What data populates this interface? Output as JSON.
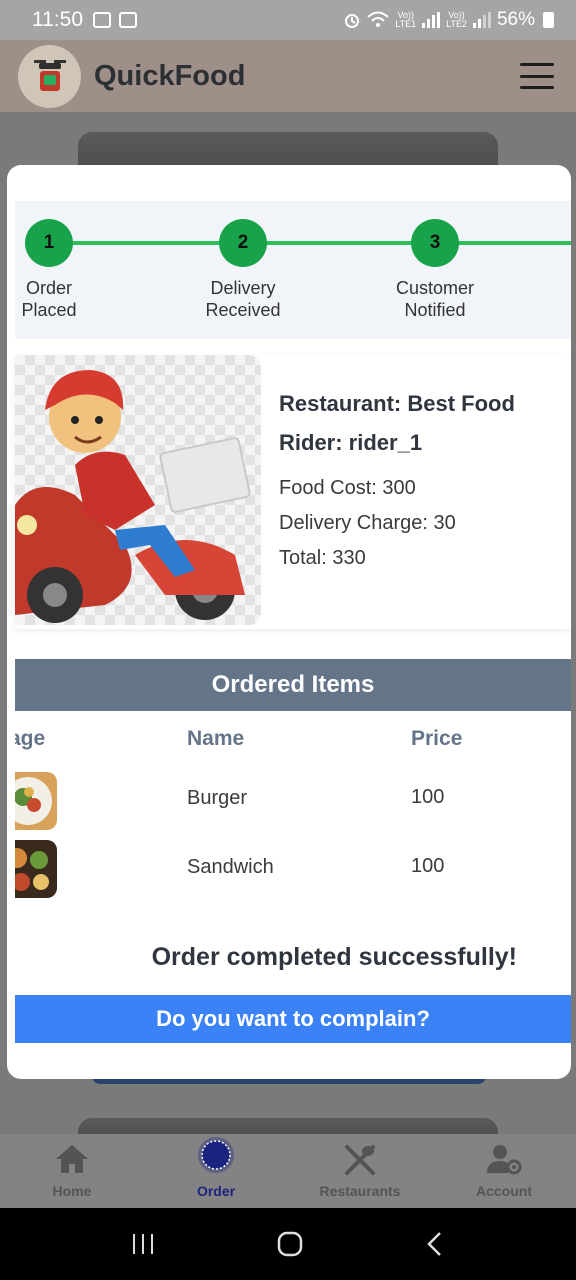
{
  "status_bar": {
    "time": "11:50",
    "battery": "56%",
    "sim1": "LTE1",
    "sim2": "LTE2",
    "volte": "Vo))"
  },
  "header": {
    "app_title": "QuickFood"
  },
  "stepper": {
    "steps": [
      {
        "number": "1",
        "label_line1": "Order",
        "label_line2": "Placed"
      },
      {
        "number": "2",
        "label_line1": "Delivery",
        "label_line2": "Received"
      },
      {
        "number": "3",
        "label_line1": "Customer",
        "label_line2": "Notified"
      }
    ]
  },
  "order": {
    "restaurant": "Restaurant: Best Food",
    "rider": "Rider: rider_1",
    "food_cost": "Food Cost: 300",
    "delivery_charge": "Delivery Charge: 30",
    "total": "Total: 330"
  },
  "items": {
    "title": "Ordered Items",
    "columns": {
      "image": "age",
      "name": "Name",
      "price": "Price"
    },
    "rows": [
      {
        "name": "Burger",
        "price": "100"
      },
      {
        "name": "Sandwich",
        "price": "100"
      }
    ]
  },
  "success_message": "Order completed successfully!",
  "complain_button": "Do you want to complain?",
  "bottom_nav": [
    {
      "label": "Home",
      "icon": "home-icon"
    },
    {
      "label": "Order",
      "icon": "order-icon",
      "active": true
    },
    {
      "label": "Restaurants",
      "icon": "fork-knife-icon"
    },
    {
      "label": "Account",
      "icon": "account-settings-icon"
    }
  ],
  "colors": {
    "accent_green": "#18a34a",
    "header_slate": "#647489",
    "button_blue": "#3b82f6",
    "active_nav": "#1a237e"
  }
}
